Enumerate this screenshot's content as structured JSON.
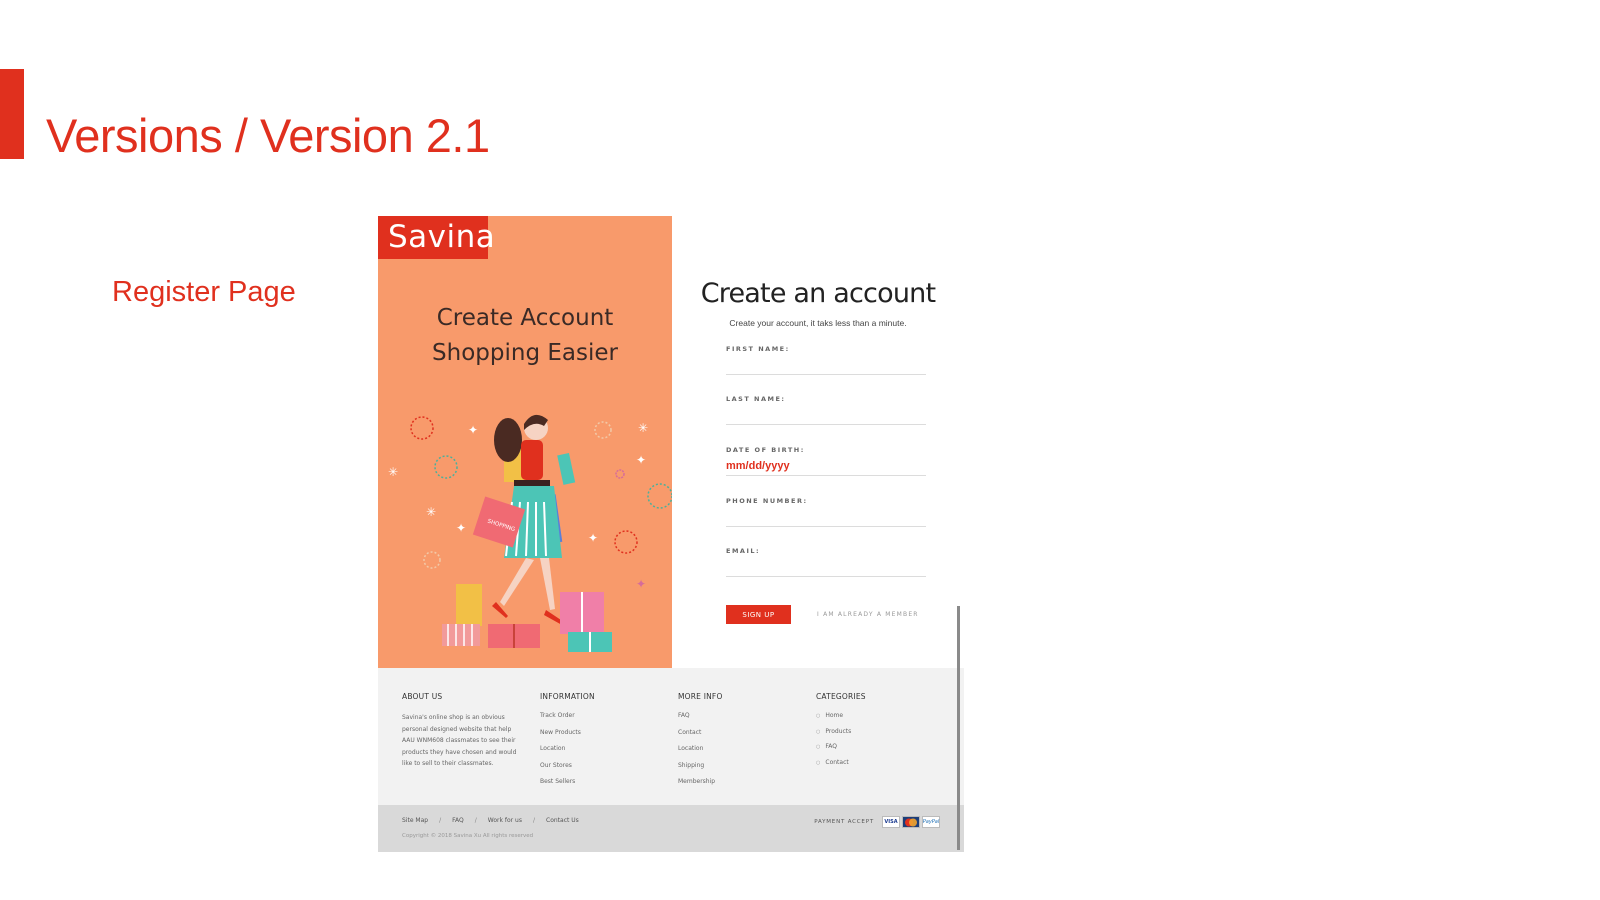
{
  "slide": {
    "title": "Versions / Version 2.1",
    "page_label": "Register Page",
    "accent_color": "#e0301e"
  },
  "promo": {
    "logo": "Savina",
    "heading_line1": "Create Account",
    "heading_line2": "Shopping Easier",
    "background_color": "#f89a6b",
    "bag_text": "SHOPPING"
  },
  "form": {
    "title": "Create an account",
    "subtitle": "Create your account, it taks less than a minute.",
    "fields": [
      {
        "label": "FIRST NAME:",
        "value": ""
      },
      {
        "label": "LAST NAME:",
        "value": ""
      },
      {
        "label": "DATE OF BIRTH:",
        "value": "mm/dd/yyyy"
      },
      {
        "label": "PHONE NUMBER:",
        "value": ""
      },
      {
        "label": "EMAIL:",
        "value": ""
      }
    ],
    "signup_label": "SIGN UP",
    "member_link": "I AM ALREADY A MEMBER"
  },
  "footer": {
    "about": {
      "title": "ABOUT US",
      "text": "Savina's online shop is an obvious personal designed website that help AAU WNM608 classmates to see their products they have chosen and would like to sell to their classmates."
    },
    "information": {
      "title": "INFORMATION",
      "links": [
        "Track Order",
        "New Products",
        "Location",
        "Our Stores",
        "Best Sellers"
      ]
    },
    "more_info": {
      "title": "MORE INFO",
      "links": [
        "FAQ",
        "Contact",
        "Location",
        "Shipping",
        "Membership"
      ]
    },
    "categories": {
      "title": "CATEGORIES",
      "links": [
        "Home",
        "Products",
        "FAQ",
        "Contact"
      ]
    }
  },
  "bottombar": {
    "links": [
      "Site Map",
      "FAQ",
      "Work for us",
      "Contact Us"
    ],
    "separator": "/",
    "copyright": "Copyright © 2018 Savina Xu All rights reserved",
    "payment_label": "PAYMENT ACCEPT",
    "cards": [
      "VISA",
      "",
      "PayPal"
    ]
  }
}
